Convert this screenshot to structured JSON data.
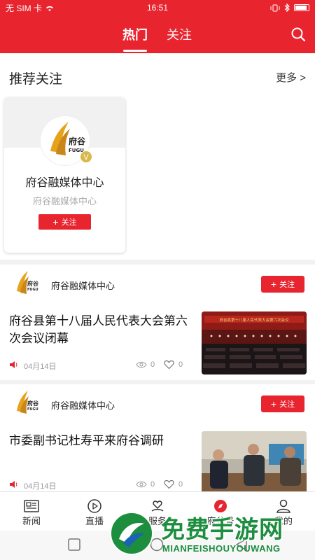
{
  "status_bar": {
    "carrier": "无 SIM 卡",
    "time": "16:51"
  },
  "header": {
    "tabs": [
      {
        "label": "热门",
        "active": true
      },
      {
        "label": "关注",
        "active": false
      }
    ],
    "search_icon": "search-icon",
    "accent_color": "#e8242f"
  },
  "recommend": {
    "title": "推荐关注",
    "more": "更多 >",
    "card": {
      "name": "府谷融媒体中心",
      "desc": "府谷融媒体中心",
      "follow": "关注",
      "badge": "V",
      "logo_text": "府谷",
      "logo_sub": "FUGU"
    }
  },
  "news": [
    {
      "source": "府谷融媒体中心",
      "follow": "关注",
      "title": "府谷县第十八届人民代表大会第六次会议闭幕",
      "date": "04月14日",
      "views": "0",
      "likes": "0",
      "thumb_banner": "府谷县第十八届人民代表大会第六次会议"
    },
    {
      "source": "府谷融媒体中心",
      "follow": "关注",
      "title": "市委副书记杜寿平来府谷调研",
      "date": "04月14日",
      "views": "0",
      "likes": "0"
    }
  ],
  "bottom_nav": [
    {
      "label": "新闻",
      "icon": "newspaper-icon"
    },
    {
      "label": "直播",
      "icon": "play-circle-icon"
    },
    {
      "label": "服务",
      "icon": "heart-hand-icon"
    },
    {
      "label": "府谷号",
      "icon": "compass-icon"
    },
    {
      "label": "我的",
      "icon": "user-icon"
    }
  ],
  "watermark": {
    "text": "免费手游网",
    "sub": "MIANFEISHOUYOUWANG"
  }
}
